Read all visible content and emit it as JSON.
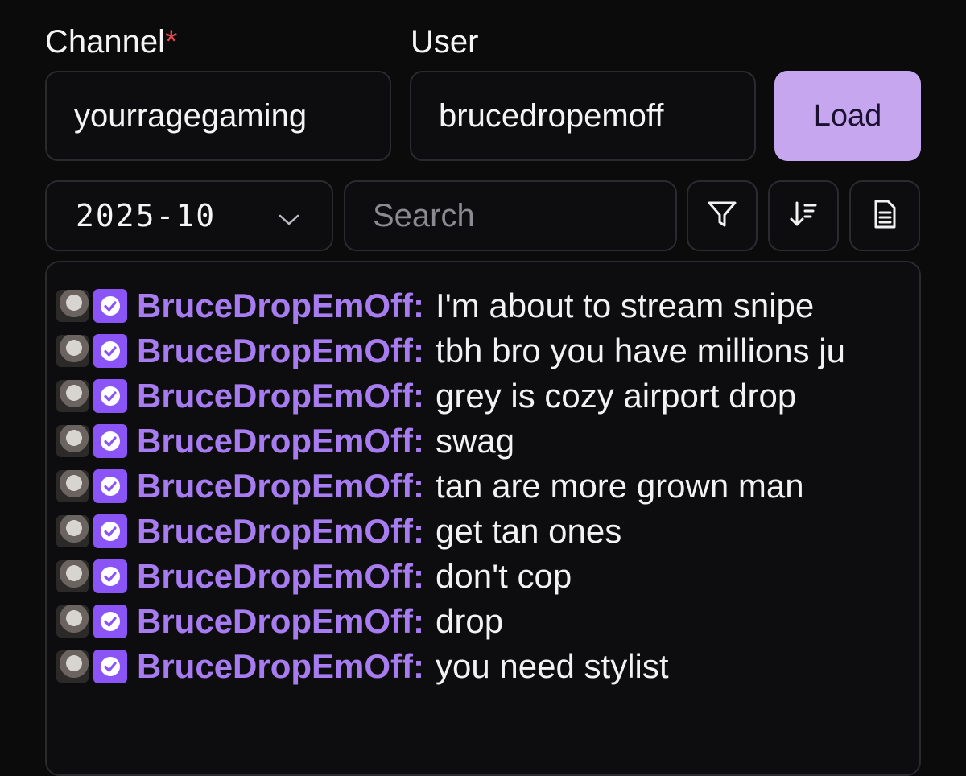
{
  "form": {
    "channel_label": "Channel",
    "required_mark": "*",
    "channel_value": "yourragegaming",
    "user_label": "User",
    "user_value": "brucedropemoff",
    "load_label": "Load"
  },
  "toolbar": {
    "month_value": "2025-10",
    "search_placeholder": "Search",
    "icons": [
      "filter-icon",
      "sort-descending-icon",
      "document-icon"
    ]
  },
  "messages": [
    {
      "user": "BruceDropEmOff:",
      "text": "I'm about to stream snipe"
    },
    {
      "user": "BruceDropEmOff:",
      "text": "tbh bro you have millions ju"
    },
    {
      "user": "BruceDropEmOff:",
      "text": "grey is cozy airport drop"
    },
    {
      "user": "BruceDropEmOff:",
      "text": "swag"
    },
    {
      "user": "BruceDropEmOff:",
      "text": "tan are more grown man"
    },
    {
      "user": "BruceDropEmOff:",
      "text": "get tan ones"
    },
    {
      "user": "BruceDropEmOff:",
      "text": "don't cop"
    },
    {
      "user": "BruceDropEmOff:",
      "text": "drop"
    },
    {
      "user": "BruceDropEmOff:",
      "text": "you need stylist"
    }
  ],
  "colors": {
    "background": "#0b0b0c",
    "accent": "#c6a6ef",
    "username": "#a77cf0",
    "badge": "#8b54f7",
    "required": "#e5484d"
  }
}
